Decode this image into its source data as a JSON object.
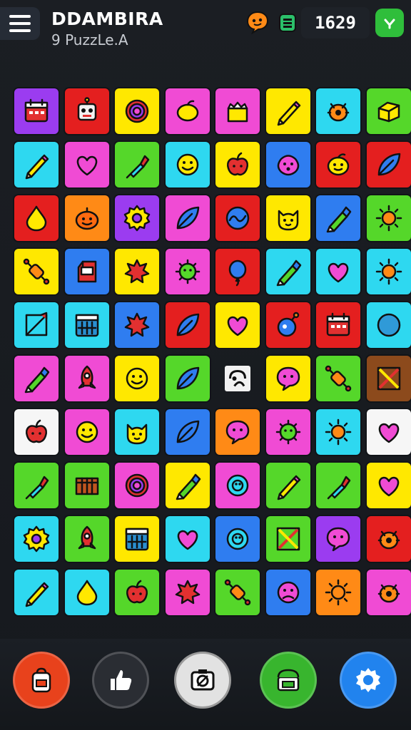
{
  "header": {
    "title": "DDAMBIRA",
    "subtitle": "9 PuzzLe.A",
    "score": "1629",
    "menu_icon": "hamburger-menu-icon",
    "hint_icon": "chat-bubble-icon",
    "coin_icon": "battery-icon",
    "check_icon": "check-icon"
  },
  "colors": {
    "background": "#16191e",
    "purple": "#9b3cf0",
    "red": "#e41f1f",
    "yellow": "#ffe800",
    "pink": "#f04bd4",
    "cyan": "#2ed8f0",
    "green": "#55d72a",
    "blue": "#2f7df0",
    "orange": "#ff8a16",
    "white": "#f6f6f6",
    "brown": "#8c4a1c"
  },
  "board": {
    "rows": [
      [
        {
          "color": "purple",
          "icon": "calendar-icon"
        },
        {
          "color": "red",
          "icon": "robot-icon"
        },
        {
          "color": "yellow",
          "icon": "target-icon"
        },
        {
          "color": "pink",
          "icon": "lemon-icon"
        },
        {
          "color": "pink",
          "icon": "cake-icon"
        },
        {
          "color": "yellow",
          "icon": "pencil-icon"
        },
        {
          "color": "cyan",
          "icon": "bug-icon"
        },
        {
          "color": "green",
          "icon": "block-icon"
        }
      ],
      [
        {
          "color": "cyan",
          "icon": "pencil-icon"
        },
        {
          "color": "pink",
          "icon": "heart-icon"
        },
        {
          "color": "green",
          "icon": "dropper-icon"
        },
        {
          "color": "cyan",
          "icon": "smiley-icon"
        },
        {
          "color": "yellow",
          "icon": "apple-icon"
        },
        {
          "color": "blue",
          "icon": "blob-face-icon"
        },
        {
          "color": "red",
          "icon": "lemon-face-icon"
        },
        {
          "color": "red",
          "icon": "leaf-icon"
        }
      ],
      [
        {
          "color": "red",
          "icon": "drop-icon"
        },
        {
          "color": "orange",
          "icon": "pumpkin-icon"
        },
        {
          "color": "purple",
          "icon": "gear-icon"
        },
        {
          "color": "pink",
          "icon": "leaf-icon"
        },
        {
          "color": "red",
          "icon": "wave-icon"
        },
        {
          "color": "yellow",
          "icon": "cat-face-icon"
        },
        {
          "color": "blue",
          "icon": "crayon-icon"
        },
        {
          "color": "green",
          "icon": "sun-icon"
        }
      ],
      [
        {
          "color": "yellow",
          "icon": "rolling-pin-icon"
        },
        {
          "color": "blue",
          "icon": "milk-box-icon"
        },
        {
          "color": "yellow",
          "icon": "splat-icon"
        },
        {
          "color": "pink",
          "icon": "virus-icon"
        },
        {
          "color": "red",
          "icon": "balloon-icon"
        },
        {
          "color": "cyan",
          "icon": "crayon-icon"
        },
        {
          "color": "cyan",
          "icon": "heart-icon"
        },
        {
          "color": "cyan",
          "icon": "sun-icon"
        }
      ],
      [
        {
          "color": "cyan",
          "icon": "easel-icon"
        },
        {
          "color": "cyan",
          "icon": "calendar-grid-icon"
        },
        {
          "color": "blue",
          "icon": "splat-icon"
        },
        {
          "color": "red",
          "icon": "leaf-icon"
        },
        {
          "color": "yellow",
          "icon": "heart-icon"
        },
        {
          "color": "red",
          "icon": "bomb-icon"
        },
        {
          "color": "red",
          "icon": "calendar-icon"
        },
        {
          "color": "cyan",
          "icon": "circle-icon"
        }
      ],
      [
        {
          "color": "pink",
          "icon": "crayon-icon"
        },
        {
          "color": "pink",
          "icon": "rocket-icon"
        },
        {
          "color": "yellow",
          "icon": "smiley-icon"
        },
        {
          "color": "green",
          "icon": "leaf-icon"
        },
        {
          "color": "empty",
          "icon": "empty-slot-icon"
        },
        {
          "color": "yellow",
          "icon": "chat-bubble-icon"
        },
        {
          "color": "green",
          "icon": "rolling-pin-icon"
        },
        {
          "color": "brown",
          "icon": "crossed-tools-icon"
        }
      ],
      [
        {
          "color": "white",
          "icon": "apple-icon"
        },
        {
          "color": "pink",
          "icon": "smiley-icon"
        },
        {
          "color": "cyan",
          "icon": "cat-face-icon"
        },
        {
          "color": "blue",
          "icon": "leaf-icon"
        },
        {
          "color": "orange",
          "icon": "chat-bubble-icon"
        },
        {
          "color": "pink",
          "icon": "virus-icon"
        },
        {
          "color": "cyan",
          "icon": "sun-icon"
        },
        {
          "color": "white",
          "icon": "heart-icon"
        }
      ],
      [
        {
          "color": "green",
          "icon": "dropper-icon"
        },
        {
          "color": "green",
          "icon": "crate-icon"
        },
        {
          "color": "pink",
          "icon": "target-icon"
        },
        {
          "color": "yellow",
          "icon": "crayon-icon"
        },
        {
          "color": "pink",
          "icon": "ring-icon"
        },
        {
          "color": "green",
          "icon": "pencil-icon"
        },
        {
          "color": "green",
          "icon": "dropper-icon"
        },
        {
          "color": "yellow",
          "icon": "heart-icon"
        }
      ],
      [
        {
          "color": "cyan",
          "icon": "gear-icon"
        },
        {
          "color": "green",
          "icon": "rocket-icon"
        },
        {
          "color": "yellow",
          "icon": "calendar-grid-icon"
        },
        {
          "color": "cyan",
          "icon": "heart-icon"
        },
        {
          "color": "blue",
          "icon": "ring-icon"
        },
        {
          "color": "green",
          "icon": "crossed-tools-icon"
        },
        {
          "color": "purple",
          "icon": "chat-bubble-icon"
        },
        {
          "color": "red",
          "icon": "bug-icon"
        }
      ],
      [
        {
          "color": "cyan",
          "icon": "pencil-icon"
        },
        {
          "color": "cyan",
          "icon": "drop-icon"
        },
        {
          "color": "green",
          "icon": "apple-icon"
        },
        {
          "color": "pink",
          "icon": "splat-icon"
        },
        {
          "color": "green",
          "icon": "rolling-pin-icon"
        },
        {
          "color": "blue",
          "icon": "sad-face-icon"
        },
        {
          "color": "orange",
          "icon": "sun-icon"
        },
        {
          "color": "pink",
          "icon": "bug-icon"
        }
      ]
    ]
  },
  "toolbar": {
    "buttons": [
      {
        "name": "backpack-button",
        "icon": "backpack-icon",
        "color": "#e8421c"
      },
      {
        "name": "thumbs-up-button",
        "icon": "thumbs-up-icon",
        "color": "#2a2d33"
      },
      {
        "name": "camera-button",
        "icon": "camera-icon",
        "color": "#e2e2e2"
      },
      {
        "name": "store-button",
        "icon": "store-icon",
        "color": "#38b52e"
      },
      {
        "name": "settings-button",
        "icon": "gear-icon",
        "color": "#2183ee"
      }
    ]
  }
}
